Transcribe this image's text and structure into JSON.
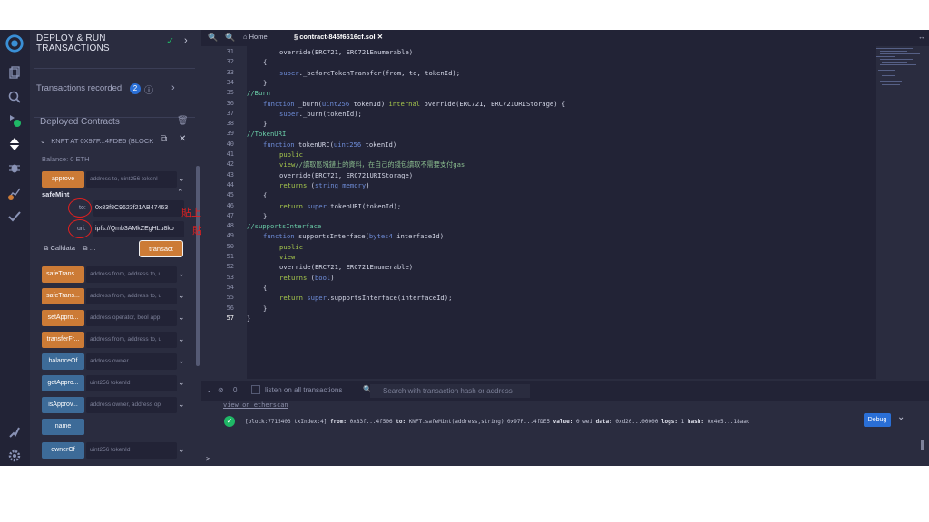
{
  "panel": {
    "title_line1": "DEPLOY & RUN",
    "title_line2": "TRANSACTIONS",
    "transactions_recorded_label": "Transactions recorded",
    "transactions_recorded_count": "2",
    "deployed_contracts_label": "Deployed Contracts",
    "contract_name": "KNFT AT 0X97F...4FDE5 (BLOCK",
    "balance": "Balance: 0 ETH",
    "functions": [
      {
        "label": "approve",
        "hint": "address to, uint256 tokenI",
        "kind": "orange"
      },
      {
        "label": "safeTrans...",
        "hint": "address from, address to, u",
        "kind": "orange"
      },
      {
        "label": "safeTrans...",
        "hint": "address from, address to, u",
        "kind": "orange"
      },
      {
        "label": "setAppro...",
        "hint": "address operator, bool app",
        "kind": "orange"
      },
      {
        "label": "transferFr...",
        "hint": "address from, address to, u",
        "kind": "orange"
      },
      {
        "label": "balanceOf",
        "hint": "address owner",
        "kind": "blue"
      },
      {
        "label": "getAppro...",
        "hint": "uint256 tokenId",
        "kind": "blue"
      },
      {
        "label": "isApprov...",
        "hint": "address owner, address op",
        "kind": "blue"
      },
      {
        "label": "name",
        "hint": "",
        "kind": "blue"
      },
      {
        "label": "ownerOf",
        "hint": "uint256 tokenId",
        "kind": "blue"
      }
    ],
    "safemint": {
      "label": "safeMint",
      "param_to_label": "to:",
      "param_to_value": "0x83f8C9623f21AB47463",
      "param_uri_label": "uri:",
      "param_uri_value": "ipfs://Qmb3AMkZEgHLu8ko",
      "calldata_label": "Calldata",
      "transact_label": "transact"
    },
    "annotation_address": "貼上錢包地址",
    "annotation_cid": "貼上CID"
  },
  "editor": {
    "tab_home": "Home",
    "tab_file": "contract-845f6516cf.sol",
    "line_numbers": [
      "31",
      "32",
      "33",
      "34",
      "35",
      "36",
      "37",
      "38",
      "39",
      "40",
      "41",
      "42",
      "43",
      "44",
      "45",
      "46",
      "47",
      "48",
      "49",
      "50",
      "51",
      "52",
      "53",
      "54",
      "55",
      "56",
      "57"
    ]
  },
  "terminal": {
    "count": "0",
    "listen_label": "listen on all transactions",
    "search_placeholder": "Search with transaction hash or address",
    "etherscan": "view on etherscan",
    "tx_block": "[block:7715403 txIndex:4]",
    "tx_from_label": "from:",
    "tx_from": "0x83f...4f506",
    "tx_to_label": "to:",
    "tx_to": "KNFT.safeMint(address,string) 0x97F...4fDE5",
    "tx_value_label": "value:",
    "tx_value": "0 wei",
    "tx_data_label": "data:",
    "tx_data": "0xd20...00000",
    "tx_logs_label": "logs:",
    "tx_logs": "1",
    "tx_hash_label": "hash:",
    "tx_hash": "0x4e5...18aac",
    "debug_label": "Debug",
    "prompt": ">"
  },
  "colors": {
    "orange": "#cc7b36",
    "blue": "#3d6b98",
    "success": "#1fb866",
    "annotation": "#e02020"
  }
}
